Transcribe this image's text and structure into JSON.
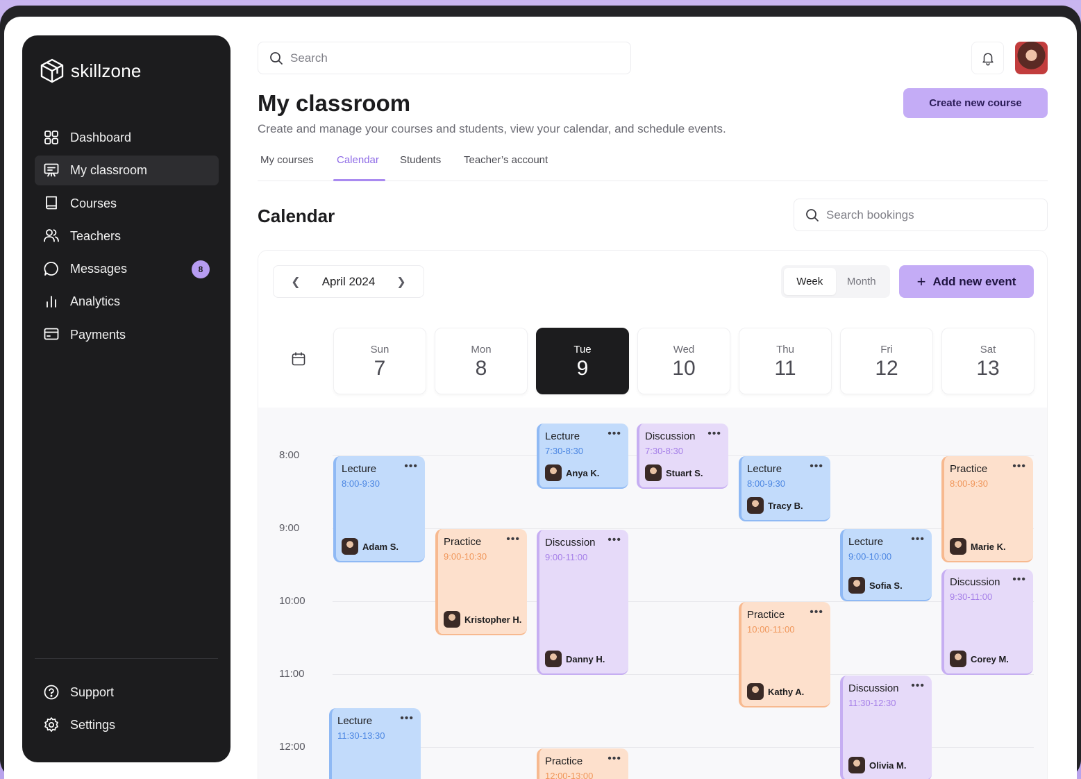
{
  "app": {
    "name": "skillzone"
  },
  "sidebar": {
    "items": [
      {
        "label": "Dashboard",
        "icon": "grid-icon"
      },
      {
        "label": "My classroom",
        "icon": "presentation-board-icon",
        "active": true
      },
      {
        "label": "Courses",
        "icon": "book-icon"
      },
      {
        "label": "Teachers",
        "icon": "users-icon"
      },
      {
        "label": "Messages",
        "icon": "chat-bubble-icon",
        "badge": "8"
      },
      {
        "label": "Analytics",
        "icon": "bar-chart-icon"
      },
      {
        "label": "Payments",
        "icon": "credit-card-icon"
      }
    ],
    "bottom": [
      {
        "label": "Support",
        "icon": "help-circle-icon"
      },
      {
        "label": "Settings",
        "icon": "gear-icon"
      }
    ]
  },
  "header": {
    "search_placeholder": "Search"
  },
  "page": {
    "title": "My classroom",
    "subtitle": "Create and manage your courses and students, view your calendar, and schedule events.",
    "create_button": "Create new course",
    "tabs": [
      "My courses",
      "Calendar",
      "Students",
      "Teacher’s account"
    ],
    "active_tab": "Calendar"
  },
  "calendar": {
    "title": "Calendar",
    "search_placeholder": "Search bookings",
    "month": "April 2024",
    "view_options": [
      "Week",
      "Month"
    ],
    "active_view": "Week",
    "add_button": "Add new event",
    "days": [
      {
        "name": "Sun",
        "date": "7"
      },
      {
        "name": "Mon",
        "date": "8"
      },
      {
        "name": "Tue",
        "date": "9",
        "active": true
      },
      {
        "name": "Wed",
        "date": "10"
      },
      {
        "name": "Thu",
        "date": "11"
      },
      {
        "name": "Fri",
        "date": "12"
      },
      {
        "name": "Sat",
        "date": "13"
      }
    ],
    "hours": [
      "8:00",
      "9:00",
      "10:00",
      "11:00",
      "12:00"
    ],
    "events": [
      {
        "title": "Lecture",
        "time": "8:00-9:30",
        "person": "Adam S.",
        "day": 0,
        "color": "blue"
      },
      {
        "title": "Lecture",
        "time": "11:30-13:30",
        "person": "",
        "day": 0,
        "color": "blue"
      },
      {
        "title": "Practice",
        "time": "9:00-10:30",
        "person": "Kristopher H.",
        "day": 1,
        "color": "orange"
      },
      {
        "title": "Lecture",
        "time": "7:30-8:30",
        "person": "Anya K.",
        "day": 2,
        "color": "blue"
      },
      {
        "title": "Discussion",
        "time": "9:00-11:00",
        "person": "Danny H.",
        "day": 2,
        "color": "purple"
      },
      {
        "title": "Practice",
        "time": "12:00-13:00",
        "person": "",
        "day": 2,
        "color": "orange"
      },
      {
        "title": "Discussion",
        "time": "7:30-8:30",
        "person": "Stuart S.",
        "day": 3,
        "color": "purple"
      },
      {
        "title": "Lecture",
        "time": "8:00-9:30",
        "person": "Tracy B.",
        "day": 4,
        "color": "blue"
      },
      {
        "title": "Practice",
        "time": "10:00-11:00",
        "person": "Kathy A.",
        "day": 4,
        "color": "orange"
      },
      {
        "title": "Lecture",
        "time": "9:00-10:00",
        "person": "Sofia S.",
        "day": 5,
        "color": "blue"
      },
      {
        "title": "Discussion",
        "time": "11:30-12:30",
        "person": "Olivia M.",
        "day": 5,
        "color": "purple"
      },
      {
        "title": "Practice",
        "time": "8:00-9:30",
        "person": "Marie K.",
        "day": 6,
        "color": "orange"
      },
      {
        "title": "Discussion",
        "time": "9:30-11:00",
        "person": "Corey M.",
        "day": 6,
        "color": "purple"
      }
    ]
  },
  "colors": {
    "accent": "#c4acf6",
    "sidebar_bg": "#1c1c1e",
    "event_blue": "#c2dbfb",
    "event_orange": "#fde0cc",
    "event_purple": "#e6daf9"
  }
}
